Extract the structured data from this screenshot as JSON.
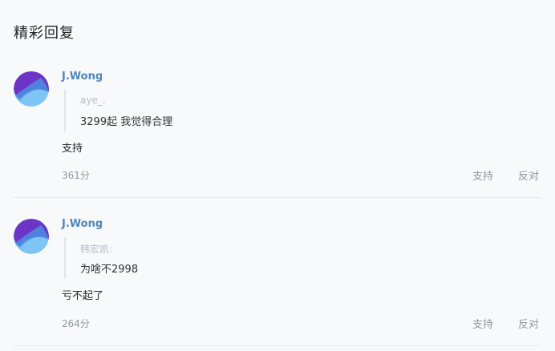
{
  "section": {
    "title": "精彩回复"
  },
  "replies": [
    {
      "username": "J.Wong",
      "quote_author": "aye_.",
      "quote_text": "3299起 我觉得合理",
      "text": "支持",
      "score": "361分",
      "support_label": "支持",
      "oppose_label": "反对"
    },
    {
      "username": "J.Wong",
      "quote_author": "韩宏凯:",
      "quote_text": "为啥不2998",
      "text": "亏不起了",
      "score": "264分",
      "support_label": "支持",
      "oppose_label": "反对"
    }
  ],
  "colors": {
    "username": "#4f86b9",
    "avatar_top": "#6d35c6",
    "avatar_bottom": "#6fb8f0"
  }
}
